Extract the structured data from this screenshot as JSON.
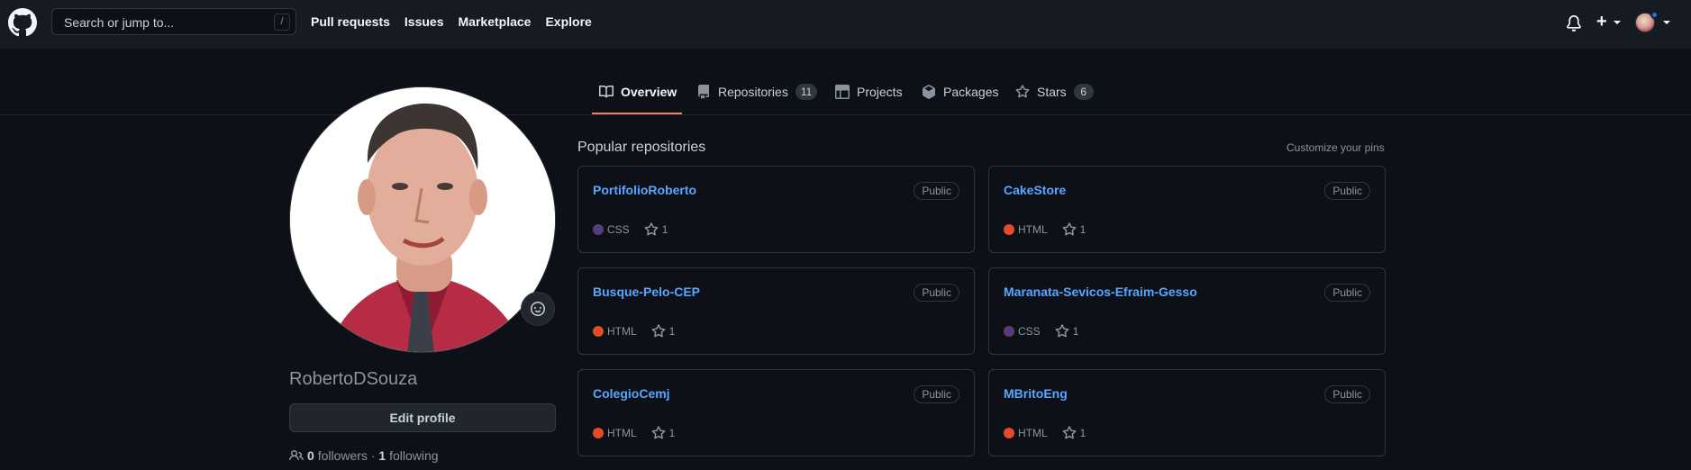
{
  "header": {
    "search_placeholder": "Search or jump to...",
    "search_shortcut": "/",
    "nav": [
      "Pull requests",
      "Issues",
      "Marketplace",
      "Explore"
    ],
    "plus_label": "+"
  },
  "tabs": [
    {
      "label": "Overview",
      "icon": "book-icon",
      "count": null,
      "active": true
    },
    {
      "label": "Repositories",
      "icon": "repo-icon",
      "count": "11",
      "active": false
    },
    {
      "label": "Projects",
      "icon": "table-icon",
      "count": null,
      "active": false
    },
    {
      "label": "Packages",
      "icon": "package-icon",
      "count": null,
      "active": false
    },
    {
      "label": "Stars",
      "icon": "star-icon",
      "count": "6",
      "active": false
    }
  ],
  "profile": {
    "username": "RobertoDSouza",
    "edit_label": "Edit profile",
    "followers_count": "0",
    "followers_label": "followers",
    "separator": "·",
    "following_count": "1",
    "following_label": "following"
  },
  "popular": {
    "title": "Popular repositories",
    "customize": "Customize your pins",
    "repos": [
      {
        "name": "PortifolioRoberto",
        "visibility": "Public",
        "lang": "CSS",
        "lang_color": "#563d7c",
        "stars": "1"
      },
      {
        "name": "CakeStore",
        "visibility": "Public",
        "lang": "HTML",
        "lang_color": "#e34c26",
        "stars": "1"
      },
      {
        "name": "Busque-Pelo-CEP",
        "visibility": "Public",
        "lang": "HTML",
        "lang_color": "#e34c26",
        "stars": "1"
      },
      {
        "name": "Maranata-Sevicos-Efraim-Gesso",
        "visibility": "Public",
        "lang": "CSS",
        "lang_color": "#563d7c",
        "stars": "1"
      },
      {
        "name": "ColegioCemj",
        "visibility": "Public",
        "lang": "HTML",
        "lang_color": "#e34c26",
        "stars": "1"
      },
      {
        "name": "MBritoEng",
        "visibility": "Public",
        "lang": "HTML",
        "lang_color": "#e34c26",
        "stars": "1"
      }
    ]
  },
  "colors": {
    "background": "#0d1117",
    "header": "#161b22",
    "link": "#58a6ff",
    "tab_underline": "#f78166",
    "notification": "#1f6feb"
  }
}
